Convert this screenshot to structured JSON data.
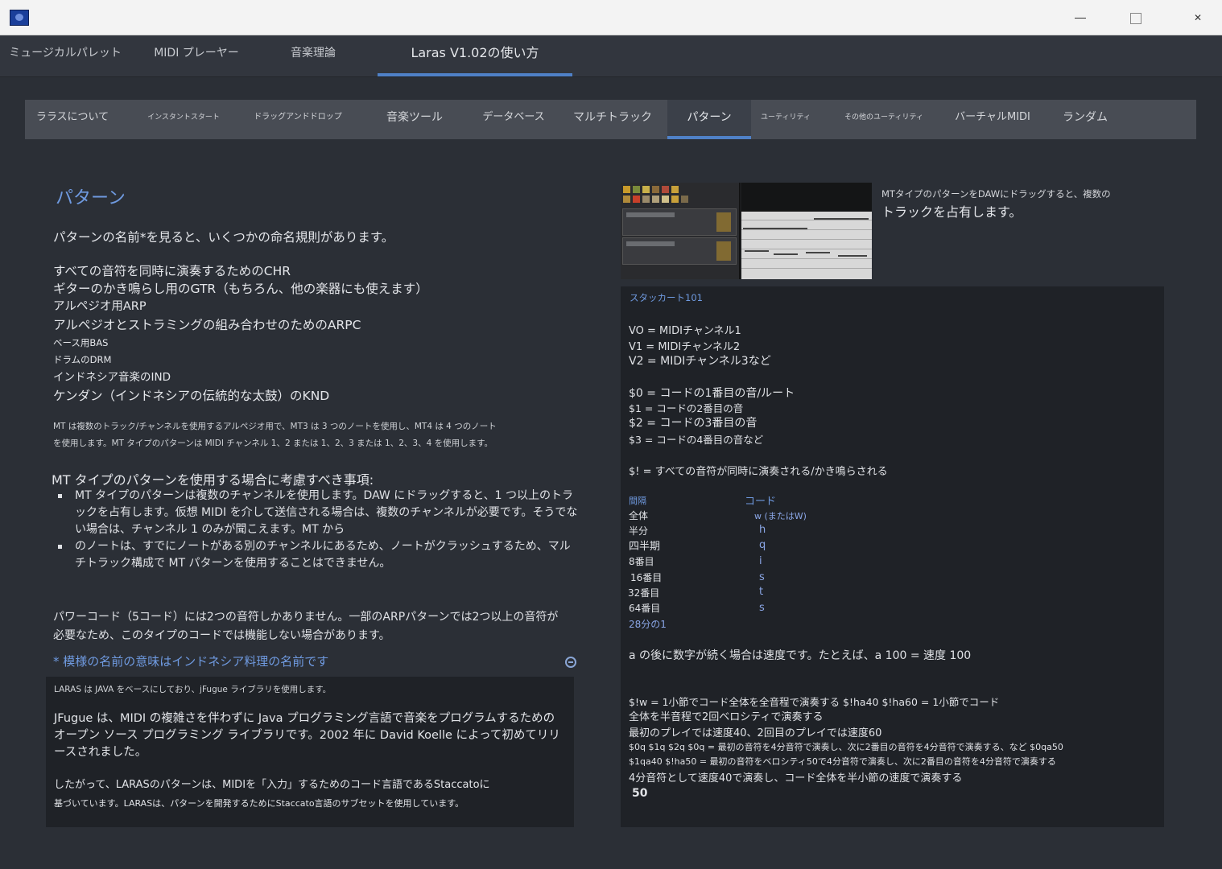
{
  "top_tabs": [
    {
      "label": "ミュージカルパレット"
    },
    {
      "label": "MIDI プレーヤー"
    },
    {
      "label": "音楽理論"
    },
    {
      "label": "Laras V1.02の使い方"
    }
  ],
  "sub_tabs": [
    {
      "label": "ララスについて"
    },
    {
      "label": "インスタントスタート"
    },
    {
      "label": "ドラッグアンドドロップ"
    },
    {
      "label": "音楽ツール"
    },
    {
      "label": "データベース"
    },
    {
      "label": "マルチトラック"
    },
    {
      "label": "パターン"
    },
    {
      "label": "ユーティリティ"
    },
    {
      "label": "その他のユーティリティ"
    },
    {
      "label": "バーチャルMIDI"
    },
    {
      "label": "ランダム"
    }
  ],
  "left": {
    "title": "パターン",
    "intro": "パターンの名前*を見ると、いくつかの命名規則があります。",
    "rules": [
      "すべての音符を同時に演奏するためのCHR",
      "ギターのかき鳴らし用のGTR（もちろん、他の楽器にも使えます）",
      "アルペジオ用ARP",
      "アルペジオとストラミングの組み合わせのためのARPC",
      "ベース用BAS",
      "ドラムのDRM",
      "インドネシア音楽のIND",
      "ケンダン（インドネシアの伝統的な太鼓）のKND"
    ],
    "mt_desc_1": "MT は複数のトラック/チャンネルを使用するアルペジオ用で、MT3 は 3 つのノートを使用し、MT4 は 4 つのノート",
    "mt_desc_2": "を使用します。MT タイプのパターンは MIDI チャンネル 1、2 または 1、2、3 または 1、2、3、4 を使用します。",
    "mt_heading": "MT タイプのパターンを使用する場合に考慮すべき事項:",
    "bullet_1": "MT タイプのパターンは複数のチャンネルを使用します。DAW にドラッグすると、1 つ以上のトラックを占有します。仮想 MIDI を介して送信される場合は、複数のチャンネルが必要です。そうでない場合は、チャンネル 1 のみが聞こえます。MT から",
    "bullet_2": "のノートは、すでにノートがある別のチャンネルにあるため、ノートがクラッシュするため、マルチトラック構成で MT パターンを使用することはできません。",
    "power_chord": "パワーコード（5コード）には2つの音符しかありません。一部のARPパターンでは2つ以上の音符が必要なため、このタイプのコードでは機能しない場合があります。",
    "footnote": "* 模様の名前の意味はインドネシア料理の名前です",
    "jfugue_1": "LARAS は JAVA をベースにしており、jFugue ライブラリを使用します。",
    "jfugue_2": "JFugue は、MIDI の複雑さを伴わずに Java プログラミング言語で音楽をプログラムするためのオープン ソース プログラミング ライブラリです。2002 年に David Koelle によって初めてリリースされました。",
    "jfugue_3a": "したがって、LARASのパターンは、MIDIを「入力」するためのコード言語であるStaccatoに",
    "jfugue_3b": "基づいています。LARASは、パターンを開発するためにStaccato言語のサブセットを使用しています。"
  },
  "right": {
    "caption_small": "MTタイプのパターンをDAWにドラッグすると、複数の",
    "caption_large": "トラックを占有します。",
    "staccato_title": "スタッカート101",
    "voices": [
      "VO = MIDIチャンネル1",
      "V1 = MIDIチャンネル2",
      "V2 = MIDIチャンネル3など"
    ],
    "notes": [
      "$0 = コードの1番目の音/ルート",
      "$1 = コードの2番目の音",
      "$2 = コードの3番目の音",
      "$3 = コードの4番目の音など"
    ],
    "all_notes": "$! = すべての音符が同時に演奏される/かき鳴らされる",
    "interval_header": "間隔",
    "code_header": "コード",
    "intervals": [
      "全体",
      "半分",
      "四半期",
      "8番目",
      "16番目",
      "32番目",
      "64番目",
      "28分の1"
    ],
    "codes": [
      "w (またはW)",
      "h",
      "q",
      "i",
      "s",
      "t",
      "s"
    ],
    "velocity": "a の後に数字が続く場合は速度です。たとえば、a 100 = 速度 100",
    "examples": [
      "$!w = 1小節でコード全体を全音程で演奏する $!ha40 $!ha60 = 1小節でコード",
      "全体を半音程で2回ベロシティで演奏する",
      "最初のプレイでは速度40、2回目のプレイでは速度60",
      "$0q $1q $2q $0q = 最初の音符を4分音符で演奏し、次に2番目の音符を4分音符で演奏する、など $0qa50",
      "$1qa40 $!ha50 = 最初の音符をベロシティ50で4分音符で演奏し、次に2番目の音符を4分音符で演奏する",
      "4分音符として速度40で演奏し、コード全体を半小節の速度で演奏する",
      "50"
    ]
  }
}
